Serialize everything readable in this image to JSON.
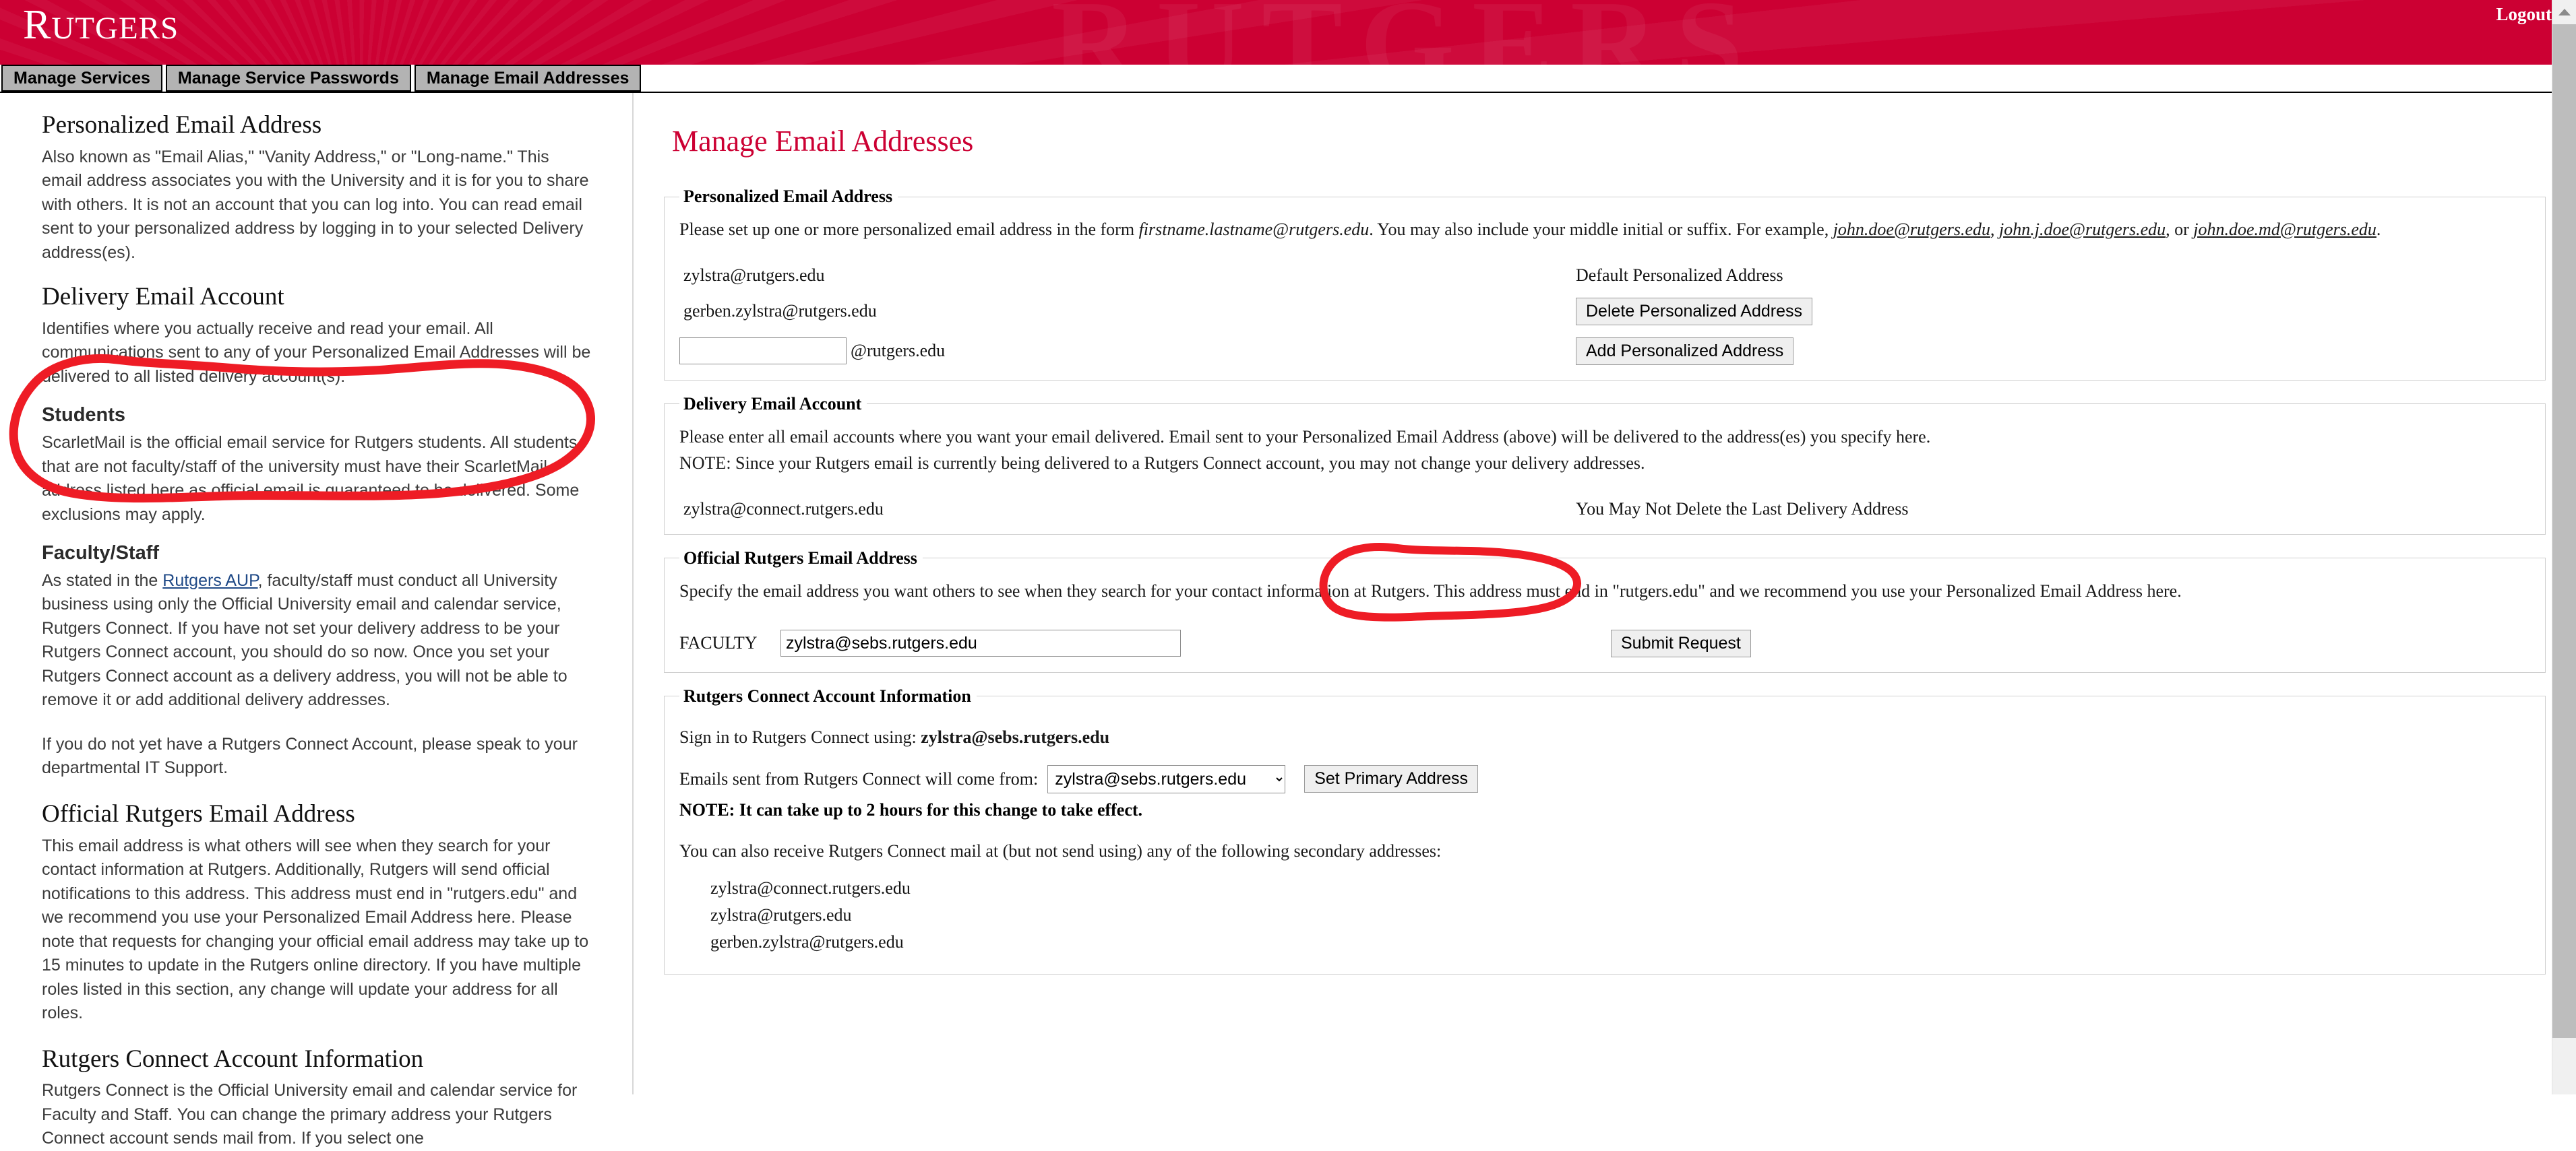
{
  "header": {
    "logo_cap": "R",
    "logo_rest": "UTGERS",
    "logout_label": "Logout",
    "brand_color": "#cc0033",
    "ghost_text": "RUTGERS"
  },
  "nav": {
    "tabs": [
      {
        "label": "Manage Services"
      },
      {
        "label": "Manage Service Passwords"
      },
      {
        "label": "Manage Email Addresses"
      }
    ]
  },
  "sidebar": {
    "sections": [
      {
        "heading": "Personalized Email Address",
        "heading_style": "serif",
        "paragraph": "Also known as \"Email Alias,\" \"Vanity Address,\" or \"Long-name.\" This email address associates you with the University and it is for you to share with others. It is not an account that you can log into. You can read email sent to your personalized address by logging in to your selected Delivery address(es)."
      },
      {
        "heading": "Delivery Email Account",
        "heading_style": "serif",
        "paragraph": "Identifies where you actually receive and read your email. All communications sent to any of your Personalized Email Addresses will be delivered to all listed delivery account(s)."
      },
      {
        "heading": "Students",
        "heading_style": "sans",
        "paragraph": "ScarletMail is the official email service for Rutgers students. All students that are not faculty/staff of the university must have their ScarletMail address listed here as official email is guaranteed to be delivered. Some exclusions may apply."
      },
      {
        "heading": "Faculty/Staff",
        "heading_style": "sans",
        "paragraph_before_link": "As stated in the ",
        "link_label": "Rutgers AUP",
        "paragraph_after_link": ", faculty/staff must conduct all University business using only the Official University email and calendar service, Rutgers Connect. If you have not set your delivery address to be your Rutgers Connect account, you should do so now. Once you set your Rutgers Connect account as a delivery address, you will not be able to remove it or add additional delivery addresses.",
        "paragraph2": "If you do not yet have a Rutgers Connect Account, please speak to your departmental IT Support."
      },
      {
        "heading": "Official Rutgers Email Address",
        "heading_style": "serif",
        "paragraph": "This email address is what others will see when they search for your contact information at Rutgers. Additionally, Rutgers will send official notifications to this address. This address must end in \"rutgers.edu\" and we recommend you use your Personalized Email Address here. Please note that requests for changing your official email address may take up to 15 minutes to update in the Rutgers online directory. If you have multiple roles listed in this section, any change will update your address for all roles."
      },
      {
        "heading": "Rutgers Connect Account Information",
        "heading_style": "serif",
        "paragraph": "Rutgers Connect is the Official University email and calendar service for Faculty and Staff. You can change the primary address your Rutgers Connect account sends mail from. If you select one"
      }
    ]
  },
  "main": {
    "title": "Manage Email Addresses",
    "personalized": {
      "legend": "Personalized Email Address",
      "intro_1": "Please set up one or more personalized email address in the form ",
      "form_example": "firstname.lastname@rutgers.edu",
      "intro_2": ". You may also include your middle initial or suffix. For example, ",
      "example_1": "john.doe@rutgers.edu",
      "example_sep_1": ", ",
      "example_2": "john.j.doe@rutgers.edu",
      "example_sep_2": ", or ",
      "example_3": "john.doe.md@rutgers.edu",
      "example_end": ".",
      "addresses": [
        {
          "email": "zylstra@rutgers.edu",
          "right_label": "Default Personalized Address",
          "right_type": "label"
        },
        {
          "email": "gerben.zylstra@rutgers.edu",
          "right_label": "Delete Personalized Address",
          "right_type": "button"
        }
      ],
      "new_alias_value": "",
      "new_alias_placeholder": "",
      "domain_suffix": "@rutgers.edu",
      "add_button": "Add Personalized Address"
    },
    "delivery": {
      "legend": "Delivery Email Account",
      "intro": "Please enter all email accounts where you want your email delivered. Email sent to your Personalized Email Address (above) will be delivered to the address(es) you specify here.",
      "note": "NOTE: Since your Rutgers email is currently being delivered to a Rutgers Connect account, you may not change your delivery addresses.",
      "address": "zylstra@connect.rutgers.edu",
      "right_label": "You May Not Delete the Last Delivery Address"
    },
    "official": {
      "legend": "Official Rutgers Email Address",
      "intro": "Specify the email address you want others to see when they search for your contact information at Rutgers. This address must end in \"rutgers.edu\" and we recommend you use your Personalized Email Address here.",
      "role_label": "FACULTY",
      "value": "zylstra@sebs.rutgers.edu",
      "submit_button": "Submit Request"
    },
    "connect": {
      "legend": "Rutgers Connect Account Information",
      "signin_prefix": "Sign in to Rutgers Connect using: ",
      "signin_address": "zylstra@sebs.rutgers.edu",
      "from_label": "Emails sent from Rutgers Connect will come from:",
      "from_selected": "zylstra@sebs.rutgers.edu",
      "from_options": [
        "zylstra@sebs.rutgers.edu",
        "zylstra@connect.rutgers.edu",
        "zylstra@rutgers.edu",
        "gerben.zylstra@rutgers.edu"
      ],
      "set_primary_button": "Set Primary Address",
      "note": "NOTE: It can take up to 2 hours for this change to take effect.",
      "secondary_intro": "You can also receive Rutgers Connect mail at (but not send using) any of the following secondary addresses:",
      "secondary_addresses": [
        "zylstra@connect.rutgers.edu",
        "zylstra@rutgers.edu",
        "gerben.zylstra@rutgers.edu"
      ]
    }
  },
  "annotations": {
    "color": "#ee1c25",
    "shapes": [
      {
        "name": "circle-delivery-email-account-sidebar"
      },
      {
        "name": "circle-delivery-email-account-main"
      }
    ]
  },
  "scrollbar": {
    "position": "right",
    "thumb_ratio": 0.92
  }
}
